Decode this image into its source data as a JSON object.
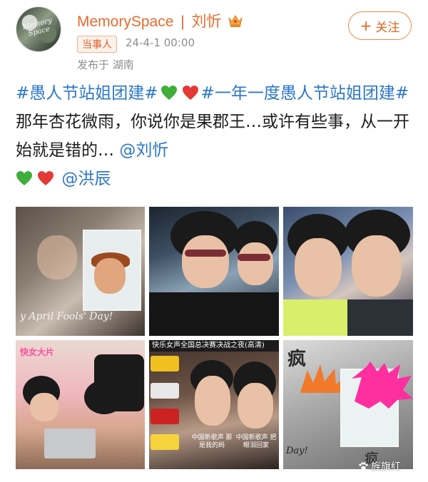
{
  "header": {
    "username": "MemorySpace",
    "separator": "|",
    "display_name": "刘忻",
    "badge": "当事人",
    "timestamp": "24-4-1 00:00",
    "location": "发布于 湖南",
    "follow_label": "关注",
    "avatar_text": "Memory Space"
  },
  "post": {
    "tag1": "#愚人节站姐团建#",
    "tag2": "#一年一度愚人节站姐团建#",
    "text1": " 那年杏花微雨，你说你是果郡王…或许有些事，从一开始就是错的… ",
    "mention1": "@刘忻",
    "mention2": "@洪辰"
  },
  "photos": {
    "p1_caption": "y April Fools' Day!",
    "p4_label": "快女大片",
    "p5_banner": "快乐女声全国总决赛决战之夜(高清)",
    "p5_sub1": "中国新歌声 那是我的妈",
    "p5_sub2": "中国新歌声 把眼泪回家",
    "p6_title": "疯",
    "p6_small": "疯",
    "p6_caption": "Day!"
  },
  "watermark": "旌旗红",
  "colors": {
    "accent_orange": "#e66b2f",
    "link_blue": "#2b77c8",
    "meta_gray": "#8d8d8d",
    "heart_green": "#3fae3a",
    "heart_red": "#e53935"
  }
}
